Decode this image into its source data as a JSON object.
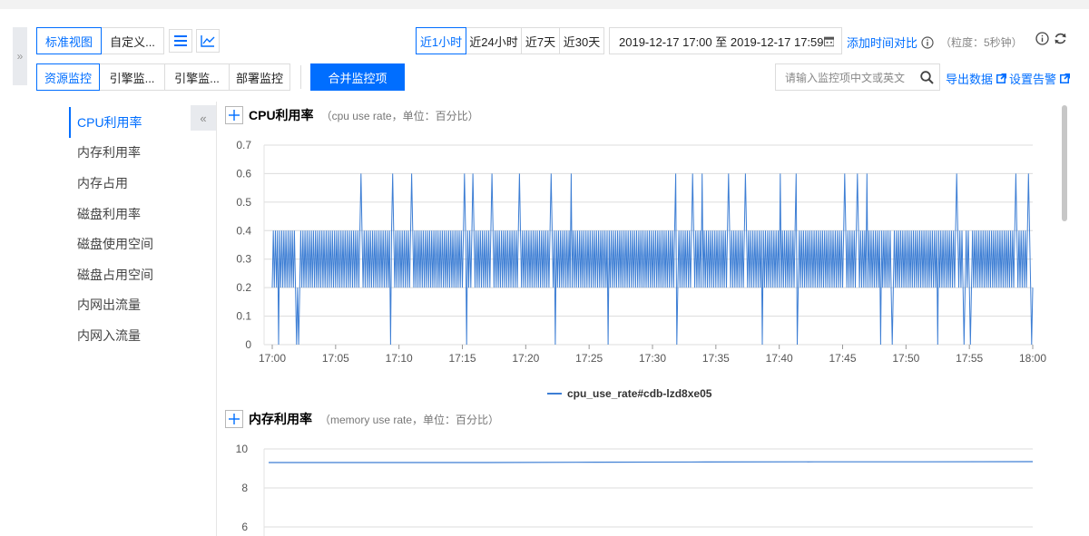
{
  "toolbar": {
    "view_tabs": [
      "标准视图",
      "自定义..."
    ],
    "time_ranges": [
      "近1小时",
      "近24小时",
      "近7天",
      "近30天"
    ],
    "date_range": "2019-12-17 17:00 至 2019-12-17 17:59",
    "add_compare": "添加时间对比",
    "granularity": "（粒度：5秒钟）",
    "monitor_tabs": [
      "资源监控",
      "引擎监...",
      "引擎监...",
      "部署监控"
    ],
    "merge_button": "合并监控项",
    "search_placeholder": "请输入监控项中文或英文",
    "export": "导出数据",
    "alarm": "设置告警"
  },
  "sidebar": {
    "items": [
      "CPU利用率",
      "内存利用率",
      "内存占用",
      "磁盘利用率",
      "磁盘使用空间",
      "磁盘占用空间",
      "内网出流量",
      "内网入流量"
    ]
  },
  "charts": [
    {
      "title": "CPU利用率",
      "subtitle": "（cpu use rate，单位：百分比）"
    },
    {
      "title": "内存利用率",
      "subtitle": "（memory use rate，单位：百分比）"
    }
  ],
  "chart_data": [
    {
      "type": "line",
      "title": "CPU利用率",
      "y_ticks": [
        "0",
        "0.1",
        "0.2",
        "0.3",
        "0.4",
        "0.5",
        "0.6",
        "0.7"
      ],
      "ylim": [
        0,
        0.7
      ],
      "x_ticks": [
        "17:00",
        "17:05",
        "17:10",
        "17:15",
        "17:20",
        "17:25",
        "17:30",
        "17:35",
        "17:40",
        "17:45",
        "17:50",
        "17:55",
        "18:00"
      ],
      "xlim_minutes": [
        0,
        60
      ],
      "grid": true,
      "legend_position": "bottom",
      "series": [
        {
          "name": "cpu_use_rate#cdb-lzd8xe05",
          "color": "#3d7ed4",
          "sample_interval_seconds": 5,
          "pattern": "oscillates between 0.2 and 0.4 every sample",
          "peaks_minutes": [
            2.1,
            7.0,
            9.5,
            11.0,
            15.2,
            15.8,
            17.3,
            19.5,
            22.0,
            23.6,
            31.8,
            33.2,
            33.9,
            36.0,
            37.3,
            40.1,
            41.3,
            45.2,
            46.2,
            46.9,
            48.0,
            54.0,
            58.7,
            59.7
          ],
          "peak_value": 0.6,
          "dips_minutes": [
            0.5,
            1.9,
            2.1,
            9.3,
            15.3,
            22.3,
            26.5,
            31.9,
            38.7,
            41.4,
            48.0,
            48.9,
            52.5,
            54.6,
            55.1,
            59.9
          ],
          "dip_value": 0.0
        }
      ]
    },
    {
      "type": "line",
      "title": "内存利用率",
      "y_ticks": [
        "10",
        "8",
        "6"
      ],
      "visible_ylim": [
        6,
        10
      ],
      "series": [
        {
          "color": "#3d7ed4",
          "values_approx": [
            9.3,
            9.3,
            9.3,
            9.32,
            9.33,
            9.34,
            9.34,
            9.35
          ]
        }
      ]
    }
  ]
}
